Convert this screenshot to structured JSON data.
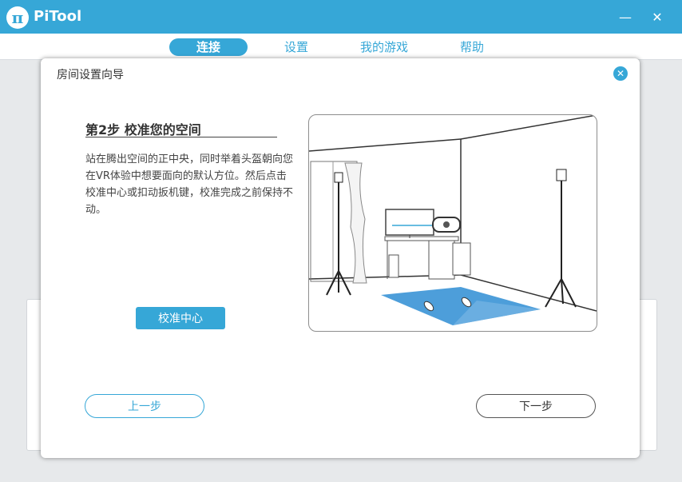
{
  "app": {
    "title": "PiTool",
    "logo_glyph": "π",
    "minimize_glyph": "—",
    "close_glyph": "✕"
  },
  "nav": {
    "tabs": [
      {
        "label": "连接",
        "active": true
      },
      {
        "label": "设置",
        "active": false
      },
      {
        "label": "我的游戏",
        "active": false
      },
      {
        "label": "帮助",
        "active": false
      }
    ]
  },
  "dialog": {
    "title": "房间设置向导",
    "close_glyph": "✕",
    "step_title": "第2步 校准您的空间",
    "description": "站在腾出空间的正中央，同时举着头盔朝向您在VR体验中想要面向的默认方位。然后点击校准中心或扣动扳机键，校准完成之前保持不动。",
    "calibrate_button": "校准中心",
    "prev_button": "上一步",
    "next_button": "下一步"
  },
  "icons": [
    "pi-logo-icon",
    "minimize-icon",
    "close-icon",
    "dialog-close-icon"
  ],
  "colors": {
    "accent": "#36a7d7",
    "floor": "#3a94d6"
  }
}
